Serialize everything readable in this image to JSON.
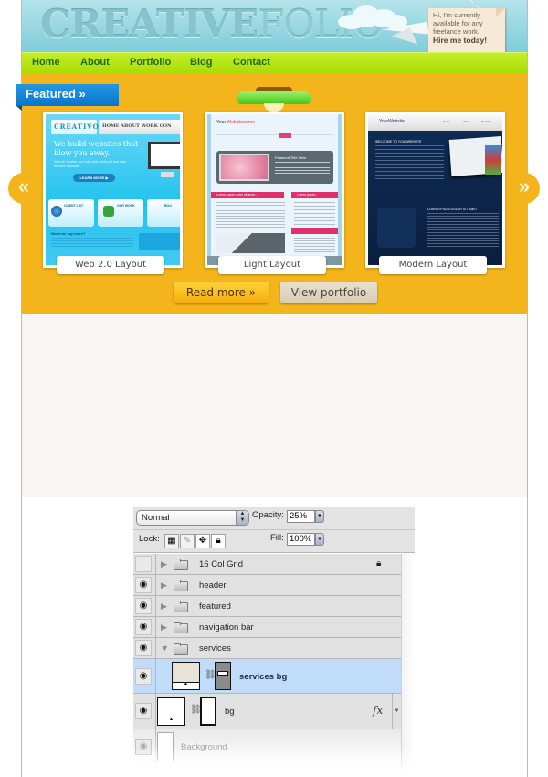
{
  "header": {
    "logo_bold": "CREATIVE",
    "logo_light": "FOLIO",
    "note_lines": [
      "Hi, I'm currently",
      "available for any",
      "freelance work."
    ],
    "note_cta": "Hire me today!"
  },
  "nav": {
    "items": [
      {
        "label": "Home"
      },
      {
        "label": "About"
      },
      {
        "label": "Portfolio"
      },
      {
        "label": "Blog"
      },
      {
        "label": "Contact"
      }
    ]
  },
  "featured": {
    "ribbon_label": "Featured »",
    "prev_arrow": "«",
    "next_arrow": "»",
    "items": [
      {
        "label": "Web 2.0 Layout",
        "mini": {
          "logo": "CREATIVO",
          "menu": "HOME  ABOUT  WORK  CON",
          "headline": "We build websites that blow you away.",
          "subtext": "Here at Creativo, we build state-of-the-art and cost-effective websites.",
          "cta": "LEARN MORE ▶",
          "boxes": [
            "CLIENT LIST",
            "OUR WORK",
            "BOO"
          ],
          "question": "Need we say more?"
        }
      },
      {
        "label": "Light Layout",
        "mini": {
          "logo_plain": "Your ",
          "logo_accent": "Websitename",
          "featured_title": "Featured Title Here",
          "section1": "Lorem ipsum dolor sit amet...",
          "section2": "Lorem ipsum..."
        }
      },
      {
        "label": "Modern Layout",
        "mini": {
          "logo": "YourWebsite",
          "tabs": [
            "Home",
            "About",
            "Portfolio"
          ],
          "welcome": "WELCOME TO YOURWEBSITE",
          "section": "LOREM IPSUM DOLOR SIT AMET"
        }
      }
    ],
    "read_more_label": "Read more »",
    "view_portfolio_label": "View portfolio"
  },
  "layers_panel": {
    "blend_mode": "Normal",
    "opacity_label": "Opacity:",
    "opacity_value": "25%",
    "lock_label": "Lock:",
    "fill_label": "Fill:",
    "fill_value": "100%",
    "layers": [
      {
        "name": "16 Col Grid",
        "type": "group",
        "visible": false,
        "locked": true
      },
      {
        "name": "header",
        "type": "group",
        "visible": true
      },
      {
        "name": "featured",
        "type": "group",
        "visible": true
      },
      {
        "name": "navigation bar",
        "type": "group",
        "visible": true
      },
      {
        "name": "services",
        "type": "group",
        "visible": true,
        "expanded": true
      },
      {
        "name": "services bg",
        "type": "shape",
        "visible": true,
        "selected": true
      },
      {
        "name": "bg",
        "type": "shape",
        "visible": true,
        "fx": "fx"
      },
      {
        "name": "Background",
        "type": "background",
        "visible": true
      }
    ],
    "colors": {
      "selected_row": "#c0dcf8",
      "row": "#e1e1e1"
    }
  },
  "colors": {
    "header_bg": "#8fd3df",
    "nav_bg": "#b4e414",
    "nav_text": "#1c6b10",
    "featured_bg": "#f4b51c",
    "ribbon": "#1587d8",
    "services_bg": "#f8f5f3"
  }
}
